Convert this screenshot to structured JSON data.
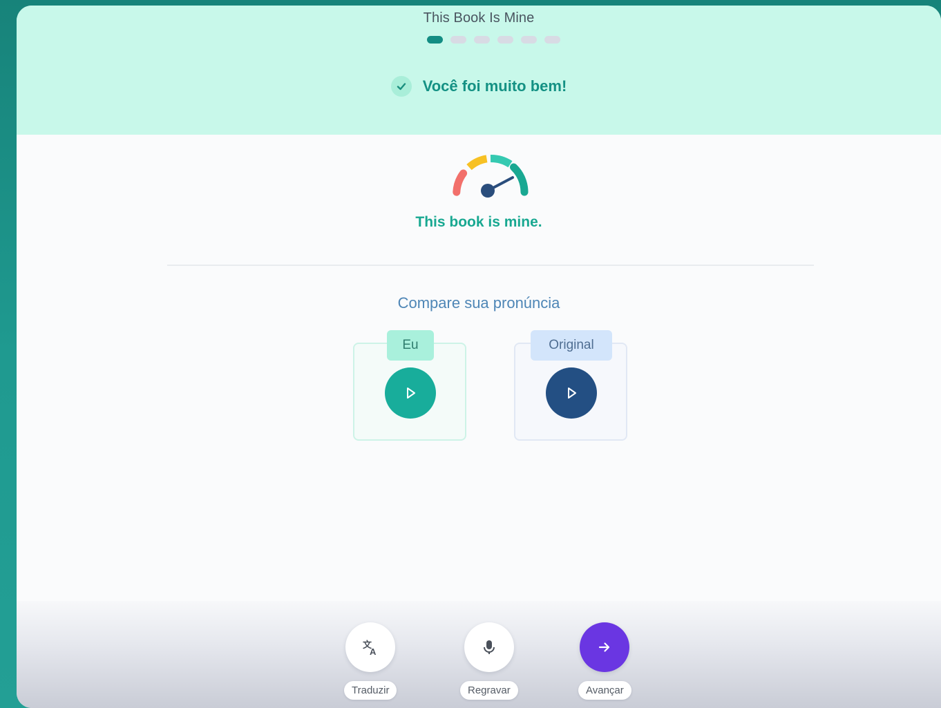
{
  "header": {
    "lesson_title": "This Book Is Mine",
    "progress": {
      "total_steps": 6,
      "current_step": 1
    },
    "feedback": {
      "icon": "check-icon",
      "text": "Você foi muito bem!"
    }
  },
  "result": {
    "score_gauge": {
      "icon": "speedometer-icon",
      "level": 0.85
    },
    "sentence": "This book is mine."
  },
  "compare": {
    "title": "Compare sua pronúncia",
    "me": {
      "tag": "Eu",
      "icon": "play-icon"
    },
    "original": {
      "tag": "Original",
      "icon": "play-icon"
    }
  },
  "actions": {
    "translate": {
      "label": "Traduzir",
      "icon": "translate-icon"
    },
    "rerecord": {
      "label": "Regravar",
      "icon": "microphone-icon"
    },
    "next": {
      "label": "Avançar",
      "icon": "arrow-right-icon"
    }
  },
  "colors": {
    "background": "#1f9a90",
    "header_band": "#c8f8ea",
    "success": "#149184",
    "my_play": "#18ad9b",
    "original_play": "#234f83",
    "primary_action": "#6a36e2"
  }
}
